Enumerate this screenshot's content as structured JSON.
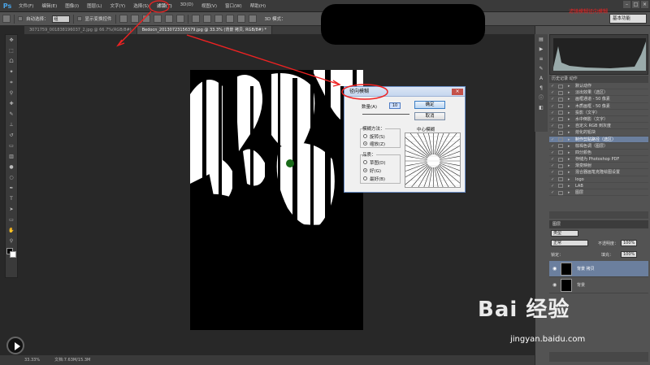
{
  "app": {
    "logo": "Ps"
  },
  "menu": [
    "文件(F)",
    "编辑(E)",
    "图像(I)",
    "图层(L)",
    "文字(Y)",
    "选择(S)",
    "滤镜(T)",
    "3D(D)",
    "视图(V)",
    "窗口(W)",
    "帮助(H)"
  ],
  "menu_highlight_index": 6,
  "options": {
    "auto_select": "自动选择：",
    "auto_select_value": "组",
    "show_transform": "显示变换控件",
    "mode_3d": "3D 模式：",
    "workspace": "基本功能"
  },
  "doc_tabs": [
    {
      "label": "3071759_001838196037_2.jpg @ 66.7%(RGB/8#)",
      "active": false
    },
    {
      "label": "Bedocn_20130723156379.jpg @ 33.3% (背景 拷贝, RGB/8#) *",
      "active": true
    }
  ],
  "status": {
    "zoom": "33.33%",
    "doc": "文档:7.63M/15.3M"
  },
  "dialog": {
    "title": "径向模糊",
    "amount_label": "数量(A)",
    "amount_value": "10",
    "ok": "确定",
    "cancel": "取消",
    "method_label": "模糊方法：",
    "method_spin": "旋转(S)",
    "method_zoom": "缩放(Z)",
    "quality_label": "品质：",
    "quality_draft": "草图(D)",
    "quality_good": "好(G)",
    "quality_best": "最好(B)",
    "center_label": "中心模糊"
  },
  "actions": {
    "tabs": "历史记录  动作",
    "items": [
      {
        "label": "默认动作",
        "selected": false
      },
      {
        "label": "淡出效果（选区）",
        "selected": false
      },
      {
        "label": "画框通道 - 50 像素",
        "selected": false
      },
      {
        "label": "木质画框 - 50 像素",
        "selected": false
      },
      {
        "label": "投影（文字）",
        "selected": false
      },
      {
        "label": "水中倒影（文字）",
        "selected": false
      },
      {
        "label": "自定义 RGB 到灰度",
        "selected": false
      },
      {
        "label": "熔化的铅块",
        "selected": false
      },
      {
        "label": "制作剪贴路径（选区）",
        "selected": true
      },
      {
        "label": "棕褐色调（图层）",
        "selected": false
      },
      {
        "label": "四分颜色",
        "selected": false
      },
      {
        "label": "存储为 Photoshop PDF",
        "selected": false
      },
      {
        "label": "渐变映射",
        "selected": false
      },
      {
        "label": "混合器画笔克隆绘图设置",
        "selected": false
      },
      {
        "label": "logo",
        "selected": false
      },
      {
        "label": "LAB",
        "selected": false
      },
      {
        "label": "图层",
        "selected": false
      }
    ]
  },
  "layers": {
    "header": "图层",
    "kind": "类型",
    "blend": "正常",
    "opacity_label": "不透明度：",
    "opacity": "100%",
    "lock_label": "锁定：",
    "fill_label": "填充：",
    "fill": "100%",
    "rows": [
      {
        "name": "背景 拷贝",
        "selected": true
      },
      {
        "name": "背景",
        "selected": false
      }
    ]
  },
  "annotation": {
    "red_text": "滤镜模糊径向模糊"
  },
  "watermark": {
    "logo": "Bai 经验",
    "site": "jingyan.baidu.com"
  }
}
